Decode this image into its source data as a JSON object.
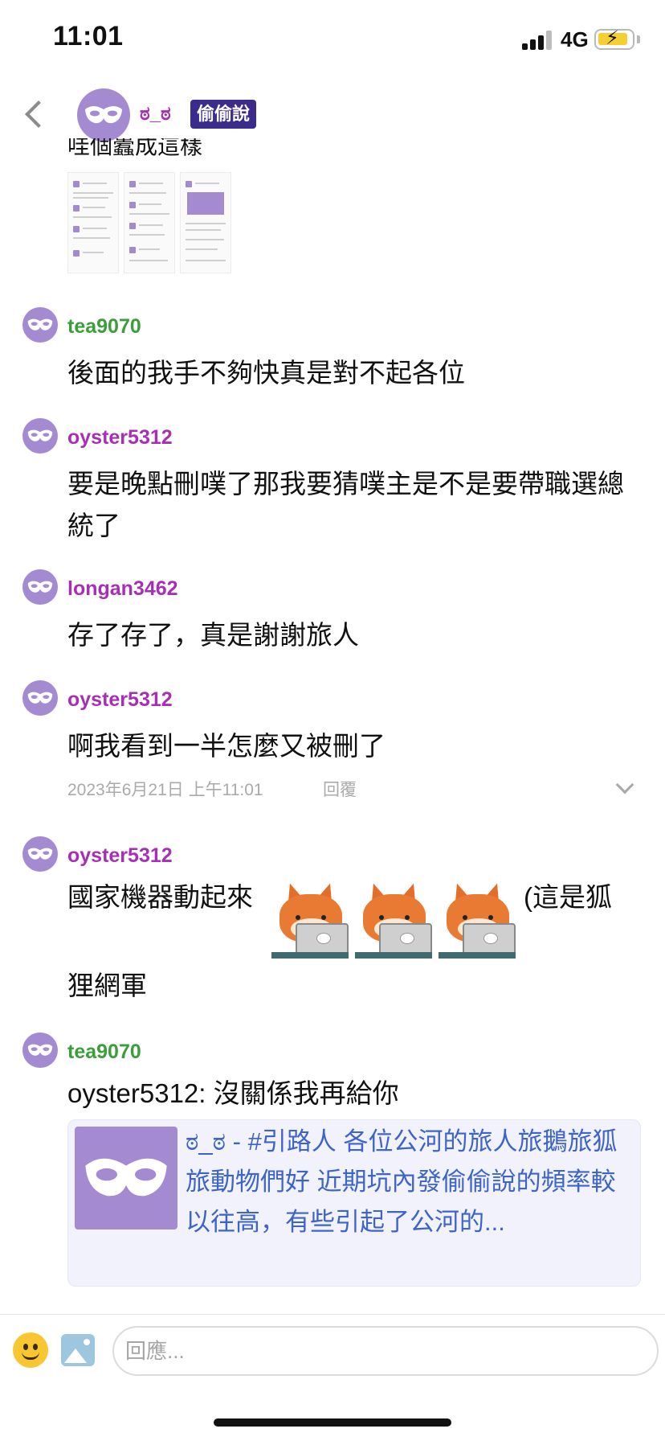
{
  "status_bar": {
    "time": "11:01",
    "network": "4G"
  },
  "header": {
    "name": "ಠ_ಠ",
    "badge": "偷偷說"
  },
  "truncated_text": "哇個蠹成這樣",
  "messages": [
    {
      "user": "tea9070",
      "text": "後面的我手不夠快真是對不起各位"
    },
    {
      "user": "oyster5312",
      "text": "要是晚點刪噗了那我要猜噗主是不是要帶職選總統了"
    },
    {
      "user": "longan3462",
      "text": "存了存了，真是謝謝旅人"
    },
    {
      "user": "oyster5312",
      "text": "啊我看到一半怎麼又被刪了",
      "timestamp": "2023年6月21日 上午11:01",
      "reply_label": "回覆"
    },
    {
      "user": "oyster5312",
      "text_before": "國家機器動起來",
      "text_after": "(這是狐",
      "text_line2": "狸網軍"
    },
    {
      "user": "tea9070",
      "text": "oyster5312: 沒關係我再給你"
    }
  ],
  "link_preview": {
    "text": "ಠ_ಠ - #引路人 各位公河的旅人旅鵝旅狐旅動物們好 近期坑內發偷偷說的頻率較以往高，有些引起了公河的..."
  },
  "composer": {
    "placeholder": "回應..."
  },
  "colors": {
    "avatar": "#a48bd1",
    "username_green": "#3a9f3a",
    "username_purple": "#a72fb5",
    "link": "#3e64c8",
    "badge_bg": "#3a2b8c"
  },
  "icons": [
    "back-icon",
    "mask-icon",
    "chevron-down-icon",
    "emoji-icon",
    "image-icon"
  ]
}
